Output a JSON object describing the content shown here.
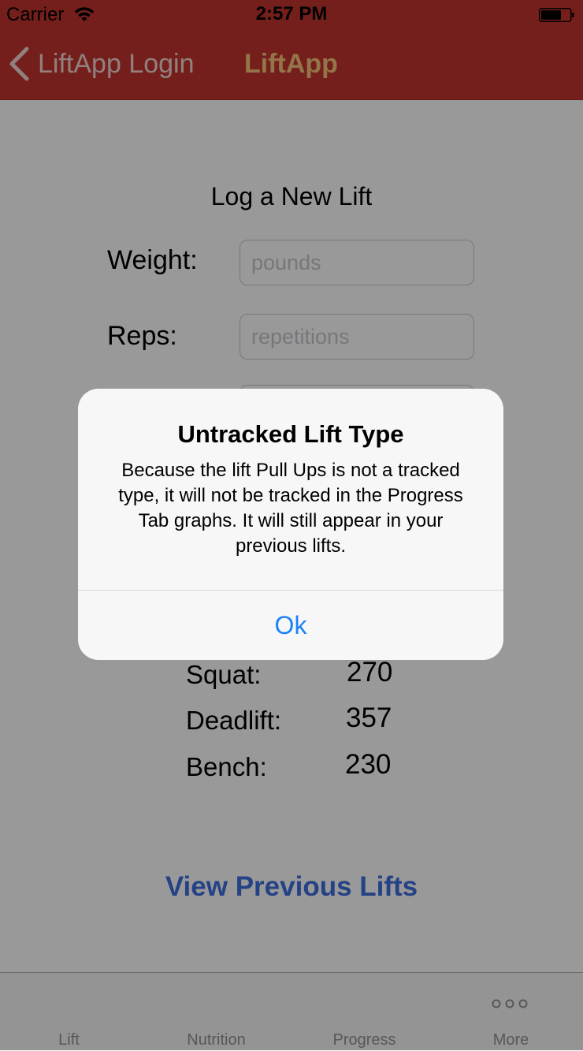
{
  "status_bar": {
    "carrier": "Carrier",
    "time": "2:57 PM",
    "wifi_icon": "wifi-icon",
    "battery_icon": "battery-icon"
  },
  "nav_bar": {
    "back_label": "LiftApp Login",
    "title": "LiftApp",
    "back_icon": "chevron-left-icon"
  },
  "form": {
    "title": "Log a New Lift",
    "weight_label": "Weight:",
    "weight_placeholder": "pounds",
    "weight_value": "",
    "reps_label": "Reps:",
    "reps_placeholder": "repetitions",
    "reps_value": ""
  },
  "maxes": [
    {
      "label": "Squat:",
      "value": "270"
    },
    {
      "label": "Deadlift:",
      "value": "357"
    },
    {
      "label": "Bench:",
      "value": "230"
    }
  ],
  "view_previous_link": "View Previous Lifts",
  "tab_bar": {
    "tabs": [
      {
        "label": "Lift"
      },
      {
        "label": "Nutrition"
      },
      {
        "label": "Progress"
      },
      {
        "label": "More",
        "icon": "more-dots-icon"
      }
    ]
  },
  "alert": {
    "title": "Untracked Lift Type",
    "message": "Because the lift Pull Ups is not a tracked type, it will not be tracked in the Progress Tab graphs. It will still appear in your previous lifts.",
    "ok_label": "Ok"
  },
  "colors": {
    "nav_bar": "#c2352f",
    "nav_title": "#f7c27a",
    "link": "#3f6fe0",
    "alert_button": "#1a82f7"
  }
}
